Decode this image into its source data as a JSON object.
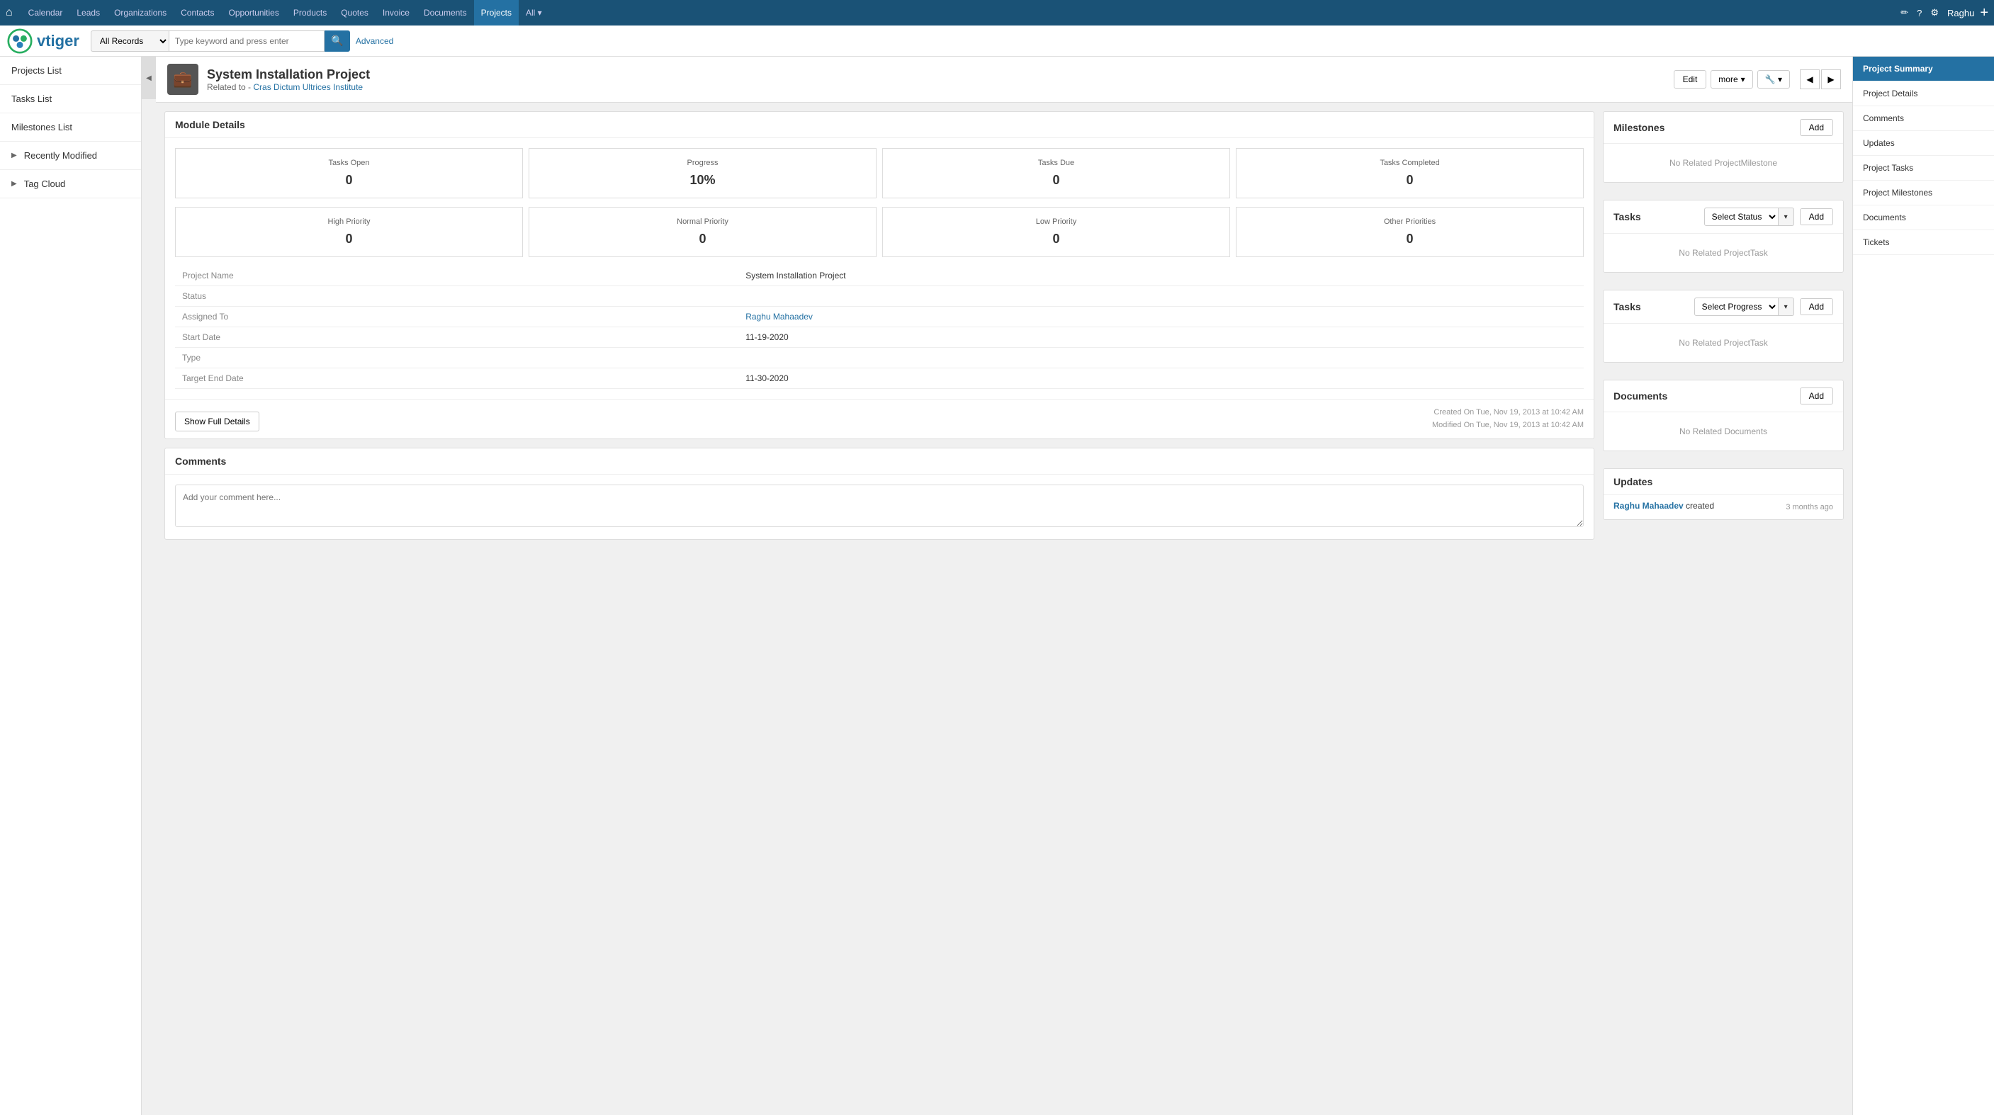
{
  "topNav": {
    "items": [
      {
        "label": "Calendar",
        "active": false
      },
      {
        "label": "Leads",
        "active": false
      },
      {
        "label": "Organizations",
        "active": false
      },
      {
        "label": "Contacts",
        "active": false
      },
      {
        "label": "Opportunities",
        "active": false
      },
      {
        "label": "Products",
        "active": false
      },
      {
        "label": "Quotes",
        "active": false
      },
      {
        "label": "Invoice",
        "active": false
      },
      {
        "label": "Documents",
        "active": false
      },
      {
        "label": "Projects",
        "active": true
      },
      {
        "label": "All ▾",
        "active": false
      }
    ],
    "rightItems": [
      "✏",
      "?",
      "⚙"
    ],
    "username": "Raghu",
    "plusLabel": "+"
  },
  "searchBar": {
    "selectLabel": "All Records",
    "inputPlaceholder": "Type keyword and press enter",
    "advancedLabel": "Advanced",
    "logoText": "vtiger"
  },
  "sidebar": {
    "items": [
      {
        "label": "Projects List",
        "arrow": false
      },
      {
        "label": "Tasks List",
        "arrow": false
      },
      {
        "label": "Milestones List",
        "arrow": false
      },
      {
        "label": "Recently Modified",
        "arrow": true
      },
      {
        "label": "Tag Cloud",
        "arrow": true
      }
    ]
  },
  "projectHeader": {
    "title": "System Installation Project",
    "relatedPrefix": "Related to -",
    "relatedLink": "Cras Dictum Ultrices Institute",
    "editLabel": "Edit",
    "moreLabel": "more",
    "toolLabel": "🔧"
  },
  "moduleDetails": {
    "sectionTitle": "Module Details",
    "stats": [
      {
        "label": "Tasks Open",
        "value": "0"
      },
      {
        "label": "Progress",
        "value": "10%"
      },
      {
        "label": "Tasks Due",
        "value": "0"
      },
      {
        "label": "Tasks Completed",
        "value": "0"
      }
    ],
    "priorities": [
      {
        "label": "High Priority",
        "value": "0"
      },
      {
        "label": "Normal Priority",
        "value": "0"
      },
      {
        "label": "Low Priority",
        "value": "0"
      },
      {
        "label": "Other Priorities",
        "value": "0"
      }
    ],
    "fields": [
      {
        "label": "Project Name",
        "value": "System Installation Project",
        "link": false
      },
      {
        "label": "Status",
        "value": "",
        "link": false
      },
      {
        "label": "Assigned To",
        "value": "Raghu Mahaadev",
        "link": true
      },
      {
        "label": "Start Date",
        "value": "11-19-2020",
        "link": false
      },
      {
        "label": "Type",
        "value": "",
        "link": false
      },
      {
        "label": "Target End Date",
        "value": "11-30-2020",
        "link": false
      }
    ],
    "showFullDetailsLabel": "Show Full Details",
    "createdOn": "Created On Tue, Nov 19, 2013 at 10:42 AM",
    "modifiedOn": "Modified On Tue, Nov 19, 2013 at 10:42 AM"
  },
  "comments": {
    "sectionTitle": "Comments",
    "placeholder": "Add your comment here..."
  },
  "milestones": {
    "title": "Milestones",
    "addLabel": "Add",
    "emptyMessage": "No Related ProjectMilestone"
  },
  "tasks1": {
    "title": "Tasks",
    "addLabel": "Add",
    "selectLabel": "Select Status",
    "emptyMessage": "No Related ProjectTask"
  },
  "tasks2": {
    "title": "Tasks",
    "addLabel": "Add",
    "selectLabel": "Select Progress",
    "emptyMessage": "No Related ProjectTask"
  },
  "documents": {
    "title": "Documents",
    "addLabel": "Add",
    "emptyMessage": "No Related Documents"
  },
  "updates": {
    "title": "Updates",
    "user": "Raghu Mahaadev",
    "action": "created",
    "timeAgo": "3 months ago"
  },
  "rightPanel": {
    "items": [
      {
        "label": "Project Summary",
        "active": true
      },
      {
        "label": "Project Details",
        "active": false
      },
      {
        "label": "Comments",
        "active": false
      },
      {
        "label": "Updates",
        "active": false
      },
      {
        "label": "Project Tasks",
        "active": false
      },
      {
        "label": "Project Milestones",
        "active": false
      },
      {
        "label": "Documents",
        "active": false
      },
      {
        "label": "Tickets",
        "active": false
      }
    ]
  },
  "colors": {
    "primary": "#2471a3",
    "navBg": "#1a5276",
    "active": "#2471a3"
  }
}
